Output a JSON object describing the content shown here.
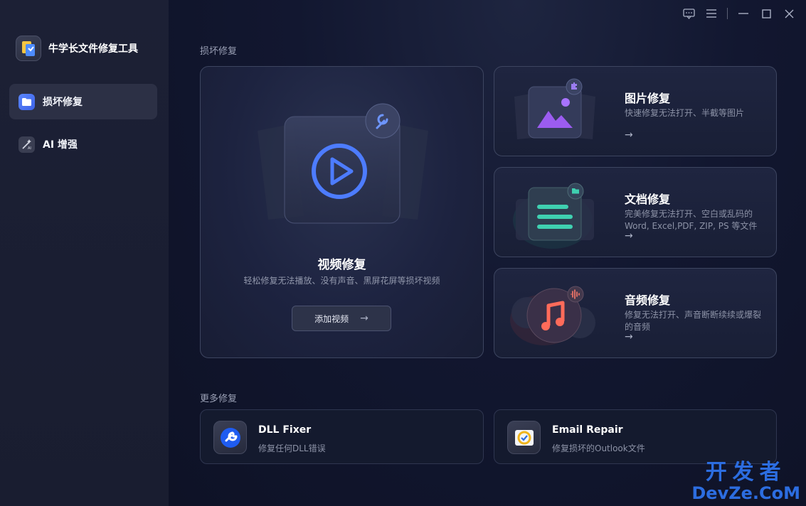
{
  "app": {
    "title": "牛学长文件修复工具"
  },
  "sidebar": {
    "items": [
      {
        "label": "损坏修复",
        "icon": "folder-icon",
        "active": true
      },
      {
        "label": "AI 增强",
        "icon": "magic-wand-icon",
        "active": false
      }
    ]
  },
  "titlebar": {
    "icons": [
      "feedback-icon",
      "menu-icon",
      "minimize-icon",
      "maximize-icon",
      "close-icon"
    ]
  },
  "main": {
    "section_damaged": "损坏修复",
    "video": {
      "title": "视频修复",
      "subtitle": "轻松修复无法播放、没有声音、黑屏花屏等损坏视频",
      "button_label": "添加视频",
      "arrow": "→"
    },
    "photo": {
      "title": "图片修复",
      "subtitle": "快速修复无法打开、半截等图片",
      "arrow": "→"
    },
    "document": {
      "title": "文档修复",
      "subtitle": "完美修复无法打开、空白或乱码的Word, Excel,PDF, ZIP, PS 等文件",
      "arrow": "→"
    },
    "audio": {
      "title": "音频修复",
      "subtitle": "修复无法打开、声音断断续续或爆裂的音频",
      "arrow": "→"
    },
    "section_more": "更多修复",
    "dll": {
      "title": "DLL Fixer",
      "subtitle": "修复任何DLL错误"
    },
    "email": {
      "title": "Email Repair",
      "subtitle": "修复损坏的Outlook文件"
    }
  },
  "watermark": {
    "cn": "开发者",
    "en": "DevZe.CoM"
  },
  "colors": {
    "accent_blue": "#4d7cff",
    "photo_purple": "#9b5cf0",
    "doc_teal": "#3fd0b0",
    "audio_red": "#ff6b5a"
  }
}
